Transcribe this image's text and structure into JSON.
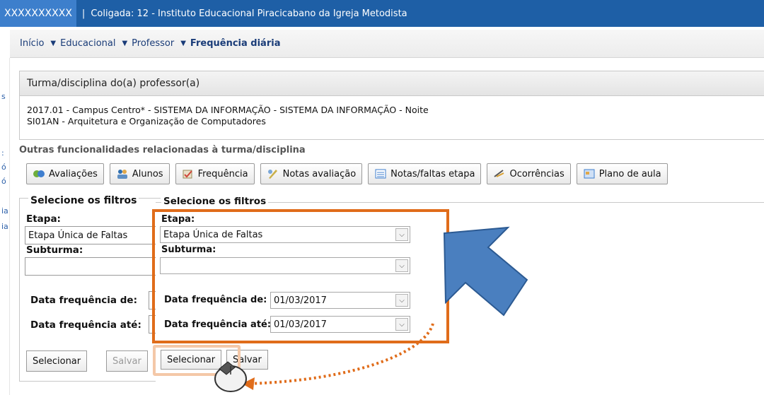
{
  "topbar": {
    "user": "XXXXXXXXXX",
    "separator": "|",
    "context": "Coligada: 12 - Instituto Educacional Piracicabano da Igreja Metodista"
  },
  "breadcrumb": {
    "items": [
      "Início",
      "Educacional",
      "Professor"
    ],
    "current": "Frequência diária"
  },
  "panel": {
    "title": "Turma/disciplina do(a) professor(a)",
    "line1": "2017.01 - Campus Centro* - SISTEMA DA INFORMAÇÃO - SISTEMA DA INFORMAÇÃO - Noite",
    "line2": "SI01AN - Arquitetura e Organização de Computadores"
  },
  "related": {
    "title": "Outras funcionalidades relacionadas à turma/disciplina",
    "buttons": [
      {
        "label": "Avaliações",
        "icon": "assessment-icon"
      },
      {
        "label": "Alunos",
        "icon": "students-icon"
      },
      {
        "label": "Frequência",
        "icon": "attendance-icon"
      },
      {
        "label": "Notas avaliação",
        "icon": "grades-icon"
      },
      {
        "label": "Notas/faltas etapa",
        "icon": "stage-grades-icon"
      },
      {
        "label": "Ocorrências",
        "icon": "occurrences-icon"
      },
      {
        "label": "Plano de aula",
        "icon": "lesson-plan-icon"
      }
    ]
  },
  "filters_back": {
    "legend": "Selecione os filtros",
    "etapa_label": "Etapa:",
    "etapa_value": "Etapa Única de Faltas",
    "subturma_label": "Subturma:",
    "data_de_label": "Data frequência de:",
    "data_ate_label": "Data frequência até:",
    "select_button": "Selecionar",
    "save_button": "Salvar"
  },
  "filters_front": {
    "legend": "Selecione os filtros",
    "etapa_label": "Etapa:",
    "etapa_value": "Etapa Única de Faltas",
    "subturma_label": "Subturma:",
    "subturma_value": "",
    "data_de_label": "Data frequência de:",
    "data_de_value": "01/03/2017",
    "data_ate_label": "Data frequência até:",
    "data_ate_value": "01/03/2017",
    "select_button": "Selecionar",
    "save_button": "Salvar"
  },
  "colors": {
    "topbar": "#1e5fa6",
    "highlight": "#e06c1a",
    "arrow": "#4a7fbf"
  }
}
